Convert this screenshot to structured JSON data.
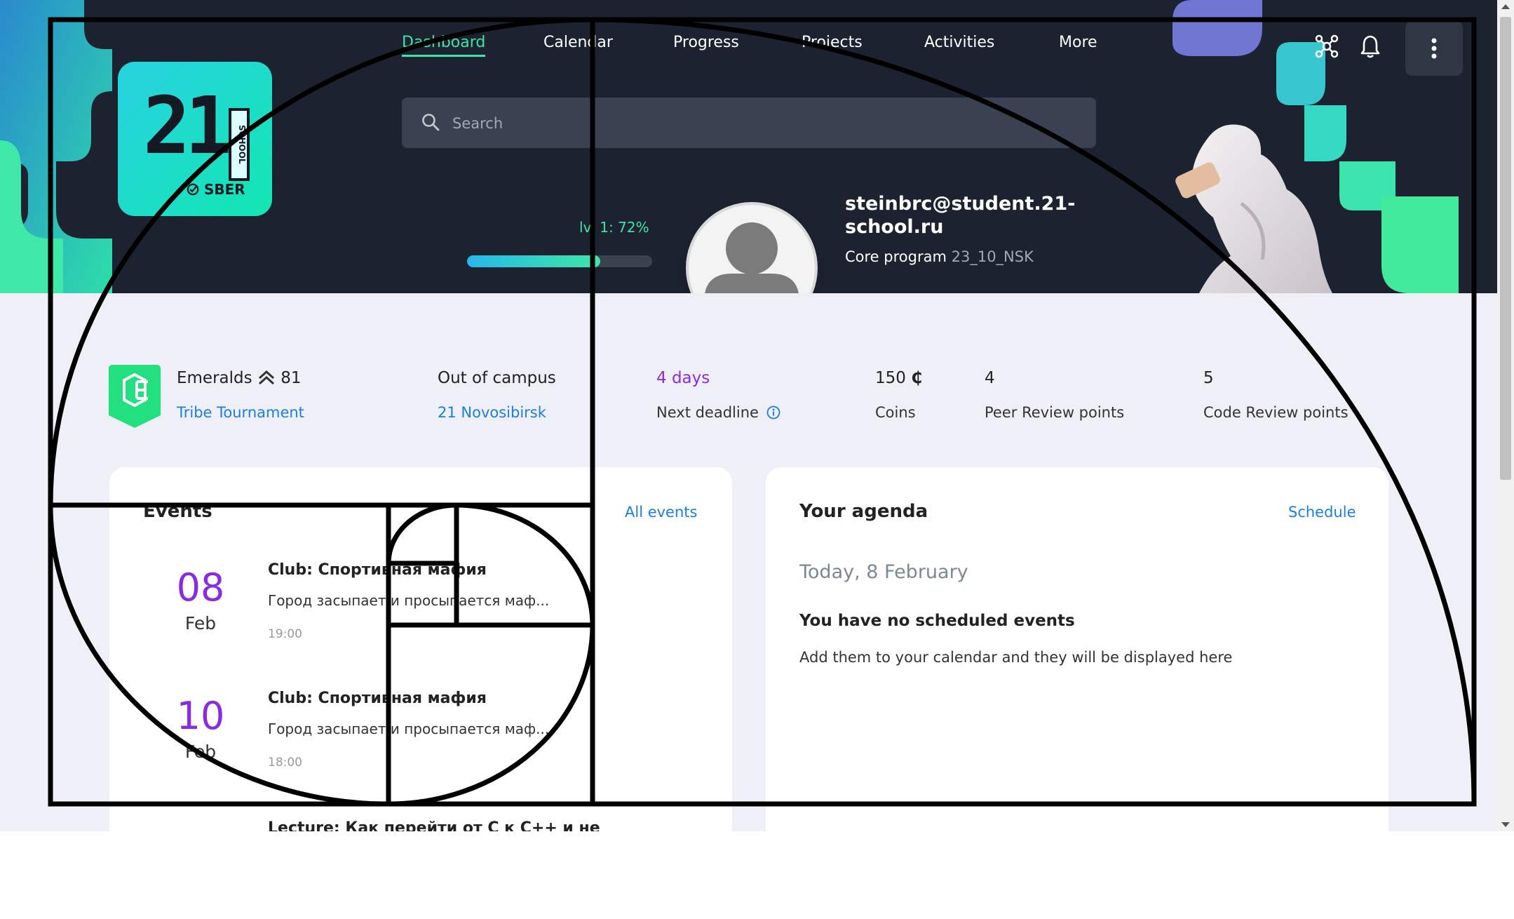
{
  "nav": {
    "items": [
      {
        "label": "Dashboard",
        "active": true
      },
      {
        "label": "Calendar"
      },
      {
        "label": "Progress"
      },
      {
        "label": "Projects"
      },
      {
        "label": "Activities"
      },
      {
        "label": "More"
      }
    ]
  },
  "logo": {
    "number": "21",
    "vertical_text": "SCHOOL",
    "brand": "SBER"
  },
  "search": {
    "placeholder": "Search",
    "value": ""
  },
  "header_icons": [
    "network-icon",
    "bell-icon",
    "more-vertical-icon"
  ],
  "profile": {
    "level_label": "lvl 1: 72%",
    "level_progress": 0.72,
    "email": "steinbrc@student.21-school.ru",
    "program_label": "Core program",
    "program_code": "23_10_NSK"
  },
  "stats": {
    "tribe": {
      "name": "Emeralds",
      "points": "81",
      "link": "Tribe Tournament"
    },
    "campus": {
      "value": "Out of campus",
      "link": "21 Novosibirsk"
    },
    "deadline": {
      "value": "4 days",
      "label": "Next deadline"
    },
    "coins": {
      "value": "150",
      "symbol": "₵",
      "label": "Coins"
    },
    "peer": {
      "value": "4",
      "label": "Peer Review points"
    },
    "code": {
      "value": "5",
      "label": "Code Review points"
    }
  },
  "events": {
    "title": "Events",
    "link": "All events",
    "items": [
      {
        "day": "08",
        "month": "Feb",
        "title": "Club: Спортивная мафия",
        "desc": "Город засыпает и просыпается маф...",
        "time": "19:00"
      },
      {
        "day": "10",
        "month": "Feb",
        "title": "Club: Спортивная мафия",
        "desc": "Город засыпает и просыпается маф...",
        "time": "18:00"
      },
      {
        "title": "Lecture: Как перейти от C к C++ и не"
      }
    ]
  },
  "agenda": {
    "title": "Your agenda",
    "link": "Schedule",
    "date": "Today, 8 February",
    "empty_title": "You have no scheduled events",
    "empty_desc": "Add them to your calendar and they will be displayed here"
  },
  "colors": {
    "header_bg": "#1c2230",
    "page_bg": "#efeff7",
    "accent_green": "#3ee3a5",
    "link_blue": "#1a7fe0",
    "date_purple": "#8a2be2"
  }
}
